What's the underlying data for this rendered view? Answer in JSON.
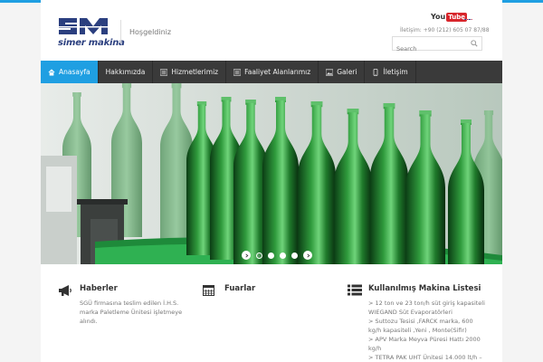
{
  "header": {
    "logo_text": "simer makina",
    "welcome": "Hoşgeldiniz",
    "phone": "İletişim: +90 (212) 605 07 87/88",
    "search_placeholder": "Search",
    "youtube_you": "You",
    "youtube_tube": "Tube"
  },
  "colors": {
    "accent": "#1f9fe2",
    "nav_bg": "#3a3a3a",
    "logo_blue": "#2b3f7f"
  },
  "nav": {
    "items": [
      {
        "label": "Anasayfa",
        "icon": "home-icon",
        "active": true
      },
      {
        "label": "Hakkımızda",
        "icon": "",
        "active": false
      },
      {
        "label": "Hizmetlerimiz",
        "icon": "list-icon",
        "active": false
      },
      {
        "label": "Faaliyet Alanlarımız",
        "icon": "list-icon",
        "active": false
      },
      {
        "label": "Galeri",
        "icon": "image-icon",
        "active": false
      },
      {
        "label": "İletişim",
        "icon": "phone-icon",
        "active": false
      }
    ]
  },
  "slider": {
    "slides": 4,
    "current": 1
  },
  "columns": [
    {
      "title": "Haberler",
      "icon": "megaphone-icon",
      "text": [
        "SGÜ firmasına teslim edilen İ.H.S.",
        "marka Paletleme Ünitesi işletmeye",
        "alındı."
      ]
    },
    {
      "title": "Fuarlar",
      "icon": "calendar-icon",
      "text": []
    },
    {
      "title": "Kullanılmış Makina Listesi",
      "icon": "list-icon",
      "text": [
        "> 12 ton ve 23 ton/h süt giriş kapasiteli",
        "WIEGAND Süt Evaporatörleri",
        "> Suttozu Tesisi ,FARCK marka, 600",
        "kg/h kapasiteli ,Yeni , Monte(Sifir)",
        "> APV Marka Meyva Püresi Hattı 2000",
        "kg/h",
        "> TETRA PAK UHT Ünitesi 14.000 lt/h –"
      ]
    }
  ]
}
